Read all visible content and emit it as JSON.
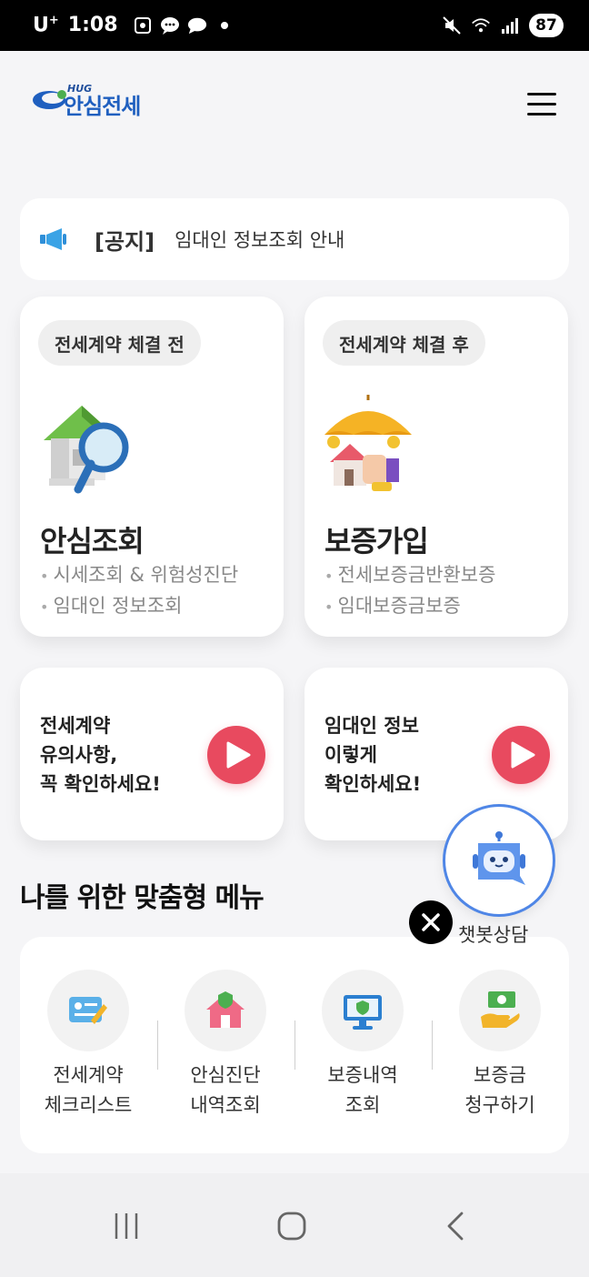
{
  "status_bar": {
    "carrier": "U",
    "carrier_sup": "+",
    "time": "1:08",
    "battery": "87",
    "icons": [
      "screenshot-icon",
      "chat-bubble-icon",
      "talk-bubble-icon",
      "dot-icon",
      "mute-icon",
      "wifi-icon",
      "signal-icon"
    ]
  },
  "header": {
    "logo_small": "HUG",
    "logo_text": "안심전세",
    "menu_icon": "hamburger-menu-icon"
  },
  "notice": {
    "tag": "[공지]",
    "text": "임대인 정보조회 안내",
    "icon": "megaphone-icon"
  },
  "cards": {
    "before": {
      "pill": "전세계약 체결 전",
      "title": "안심조회",
      "bullets": [
        "시세조회 & 위험성진단",
        "임대인 정보조회"
      ],
      "icon": "house-magnifier-icon"
    },
    "after": {
      "pill": "전세계약 체결 후",
      "title": "보증가입",
      "bullets": [
        "전세보증금반환보증",
        "임대보증금보증"
      ],
      "icon": "umbrella-house-icon"
    }
  },
  "videos": [
    {
      "text": "전세계약\n유의사항,\n꼭 확인하세요!",
      "icon": "play-icon"
    },
    {
      "text": "임대인 정보\n이렇게\n확인하세요!",
      "icon": "play-icon"
    }
  ],
  "custom_menu": {
    "title": "나를 위한 맞춤형 메뉴",
    "items": [
      {
        "label": "전세계약\n체크리스트",
        "icon": "checklist-card-icon"
      },
      {
        "label": "안심진단\n내역조회",
        "icon": "shield-house-icon"
      },
      {
        "label": "보증내역\n조회",
        "icon": "monitor-shield-icon"
      },
      {
        "label": "보증금\n청구하기",
        "icon": "money-hand-icon"
      }
    ]
  },
  "chatbot": {
    "label": "챗봇상담",
    "icon": "robot-icon",
    "close_icon": "close-icon"
  },
  "nav_bar": {
    "icons": [
      "recent-apps-icon",
      "home-icon",
      "back-icon"
    ]
  },
  "colors": {
    "accent_blue": "#1f5fbf",
    "play_red": "#e84a5f",
    "chatbot_border": "#4f86e6",
    "background": "#f5f5f7"
  }
}
